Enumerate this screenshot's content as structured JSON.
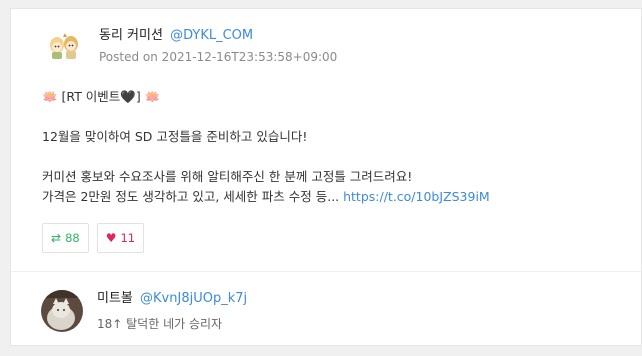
{
  "tweet": {
    "author_name": "동리 커미션",
    "author_handle": "@DYKL_COM",
    "posted": "Posted on 2021-12-16T23:53:58+09:00",
    "line1": "🪷 [RT 이벤트🖤] 🪷",
    "line2": "12월을 맞이하여 SD 고정틀을 준비하고 있습니다!",
    "line3": "커미션 홍보와 수요조사를 위해 알티해주신 한 분께 고정틀 그려드려요!",
    "line4_text": "가격은 2만원 정도 생각하고 있고, 세세한 파츠 수정 등... ",
    "line4_link": "https://t.co/10bJZS39iM",
    "retweets": "88",
    "likes": "11",
    "retweet_icon": "retweet-icon",
    "heart_icon": "heart-icon",
    "colors": {
      "link": "#3d8bd9",
      "retweet": "#32b562",
      "like": "#e0245e"
    }
  },
  "reply_user": {
    "name": "미트볼",
    "handle": "@KvnJ8jUOp_k7j",
    "bio": "18↑ 탈덕한 네가 승리자"
  }
}
